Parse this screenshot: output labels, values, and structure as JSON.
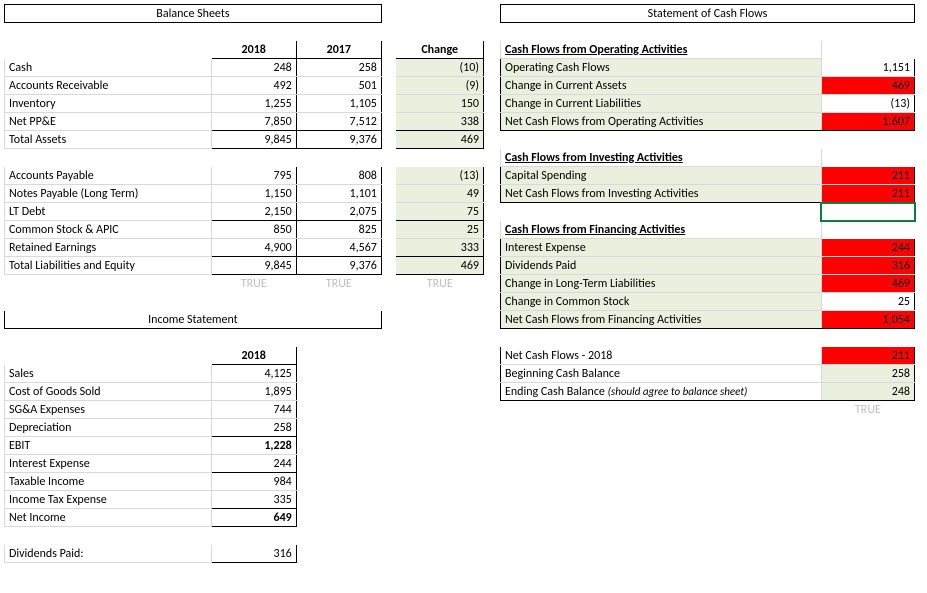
{
  "titles": {
    "balance": "Balance Sheets",
    "income": "Income Statement",
    "scf": "Statement of Cash Flows"
  },
  "headers": {
    "y2018": "2018",
    "y2017": "2017",
    "change": "Change"
  },
  "bs": {
    "cash": {
      "label": "Cash",
      "v2018": "248",
      "v2017": "258",
      "chg": "(10)"
    },
    "ar": {
      "label": "Accounts Receivable",
      "v2018": "492",
      "v2017": "501",
      "chg": "(9)"
    },
    "inv": {
      "label": "Inventory",
      "v2018": "1,255",
      "v2017": "1,105",
      "chg": "150"
    },
    "ppe": {
      "label": "Net PP&E",
      "v2018": "7,850",
      "v2017": "7,512",
      "chg": "338"
    },
    "ta": {
      "label": "Total Assets",
      "v2018": "9,845",
      "v2017": "9,376",
      "chg": "469"
    },
    "ap": {
      "label": "Accounts Payable",
      "v2018": "795",
      "v2017": "808",
      "chg": "(13)"
    },
    "np": {
      "label": "Notes Payable (Long Term)",
      "v2018": "1,150",
      "v2017": "1,101",
      "chg": "49"
    },
    "ltd": {
      "label": "LT Debt",
      "v2018": "2,150",
      "v2017": "2,075",
      "chg": "75"
    },
    "cs": {
      "label": "Common Stock & APIC",
      "v2018": "850",
      "v2017": "825",
      "chg": "25"
    },
    "re": {
      "label": "Retained Earnings",
      "v2018": "4,900",
      "v2017": "4,567",
      "chg": "333"
    },
    "tle": {
      "label": "Total Liabilities and Equity",
      "v2018": "9,845",
      "v2017": "9,376",
      "chg": "469"
    },
    "chk": {
      "v2018": "TRUE",
      "v2017": "TRUE",
      "chg": "TRUE"
    }
  },
  "is": {
    "sales": {
      "label": "Sales",
      "v": "4,125"
    },
    "cogs": {
      "label": "Cost of Goods Sold",
      "v": "1,895"
    },
    "sga": {
      "label": "SG&A Expenses",
      "v": "744"
    },
    "dep": {
      "label": "Depreciation",
      "v": "258"
    },
    "ebit": {
      "label": "EBIT",
      "v": "1,228"
    },
    "intexp": {
      "label": "Interest Expense",
      "v": "244"
    },
    "taxinc": {
      "label": "Taxable Income",
      "v": "984"
    },
    "taxexp": {
      "label": "Income Tax Expense",
      "v": "335"
    },
    "ni": {
      "label": "Net Income",
      "v": "649"
    },
    "div": {
      "label": "Dividends Paid:",
      "v": "316"
    }
  },
  "cf": {
    "op_hdr": "Cash Flows from Operating Activities",
    "ocf": {
      "label": "Operating Cash Flows",
      "v": "1,151"
    },
    "dca": {
      "label": "Change in Current Assets",
      "v": "469"
    },
    "dcl": {
      "label": "Change in Current Liabilities",
      "v": "(13)"
    },
    "netop": {
      "label": "Net Cash Flows from Operating Activities",
      "v": "1,607"
    },
    "inv_hdr": "Cash Flows from Investing Activities",
    "capex": {
      "label": "Capital Spending",
      "v": "211"
    },
    "netinv": {
      "label": "Net Cash Flows from Investing Activities",
      "v": "211"
    },
    "fin_hdr": "Cash Flows from Financing Activities",
    "intx": {
      "label": "Interest Expense",
      "v": "244"
    },
    "divp": {
      "label": "Dividends Paid",
      "v": "316"
    },
    "dltl": {
      "label": "Change in Long-Term Liabilities",
      "v": "469"
    },
    "dcs": {
      "label": "Change in Common Stock",
      "v": "25"
    },
    "netfin": {
      "label": "Net Cash Flows from Financing Activities",
      "v": "1,054"
    },
    "netcf": {
      "label": "Net Cash Flows - 2018",
      "v": "211"
    },
    "begc": {
      "label": "Beginning Cash Balance",
      "v": "258"
    },
    "endc": {
      "label": "Ending Cash Balance ",
      "note": "(should agree to balance sheet)",
      "v": "248"
    },
    "chk": "TRUE"
  }
}
